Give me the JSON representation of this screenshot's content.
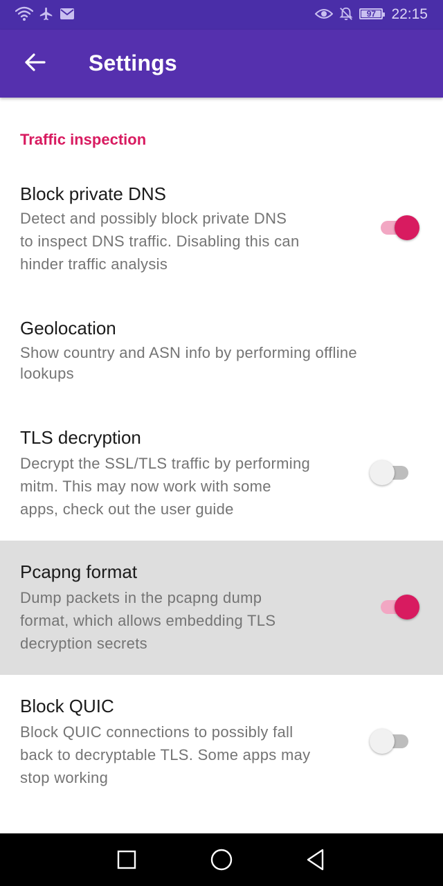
{
  "status_bar": {
    "battery": "97",
    "time": "22:15",
    "left_icons": [
      "wifi-icon",
      "airplane-icon",
      "mail-icon"
    ],
    "right_icons": [
      "eye-icon",
      "notifications-off-icon",
      "battery-icon"
    ],
    "background": "#4a2ea8"
  },
  "app_bar": {
    "title": "Settings",
    "back_icon": "arrow-back-icon",
    "background": "#5530ae"
  },
  "section": {
    "title": "Traffic inspection",
    "color": "#d81b60"
  },
  "preferences": [
    {
      "title": "Block private DNS",
      "summary_lines": [
        "Detect and possibly block private DNS",
        "to inspect DNS traffic. Disabling this can",
        "hinder traffic analysis"
      ],
      "has_switch": true,
      "checked": true
    },
    {
      "title": "Geolocation",
      "summary_lines": [
        "Show country and ASN info by performing offline",
        "lookups"
      ],
      "has_switch": false
    },
    {
      "title": "TLS decryption",
      "summary_lines": [
        "Decrypt the SSL/TLS traffic by performing",
        "mitm. This may now work with some",
        "apps, check out the user guide"
      ],
      "has_switch": true,
      "checked": false
    },
    {
      "title": "Pcapng format",
      "summary_lines": [
        "Dump packets in the pcapng dump",
        "format, which allows embedding TLS",
        "decryption secrets"
      ],
      "has_switch": true,
      "checked": true,
      "highlighted": true
    },
    {
      "title": "Block QUIC",
      "summary_lines": [
        "Block QUIC connections to possibly fall",
        "back to decryptable TLS. Some apps may",
        "stop working"
      ],
      "has_switch": true,
      "checked": false
    }
  ],
  "nav_bar": {
    "buttons": [
      "recents-square-icon",
      "home-circle-icon",
      "back-triangle-icon"
    ]
  },
  "colors": {
    "accent": "#d81b60",
    "switch_track_on": "#f2a7c3",
    "switch_thumb_off": "#f1f1f1",
    "switch_track_off": "#bdbdbd",
    "summary_text": "#747474",
    "highlight_row": "#dedede"
  }
}
